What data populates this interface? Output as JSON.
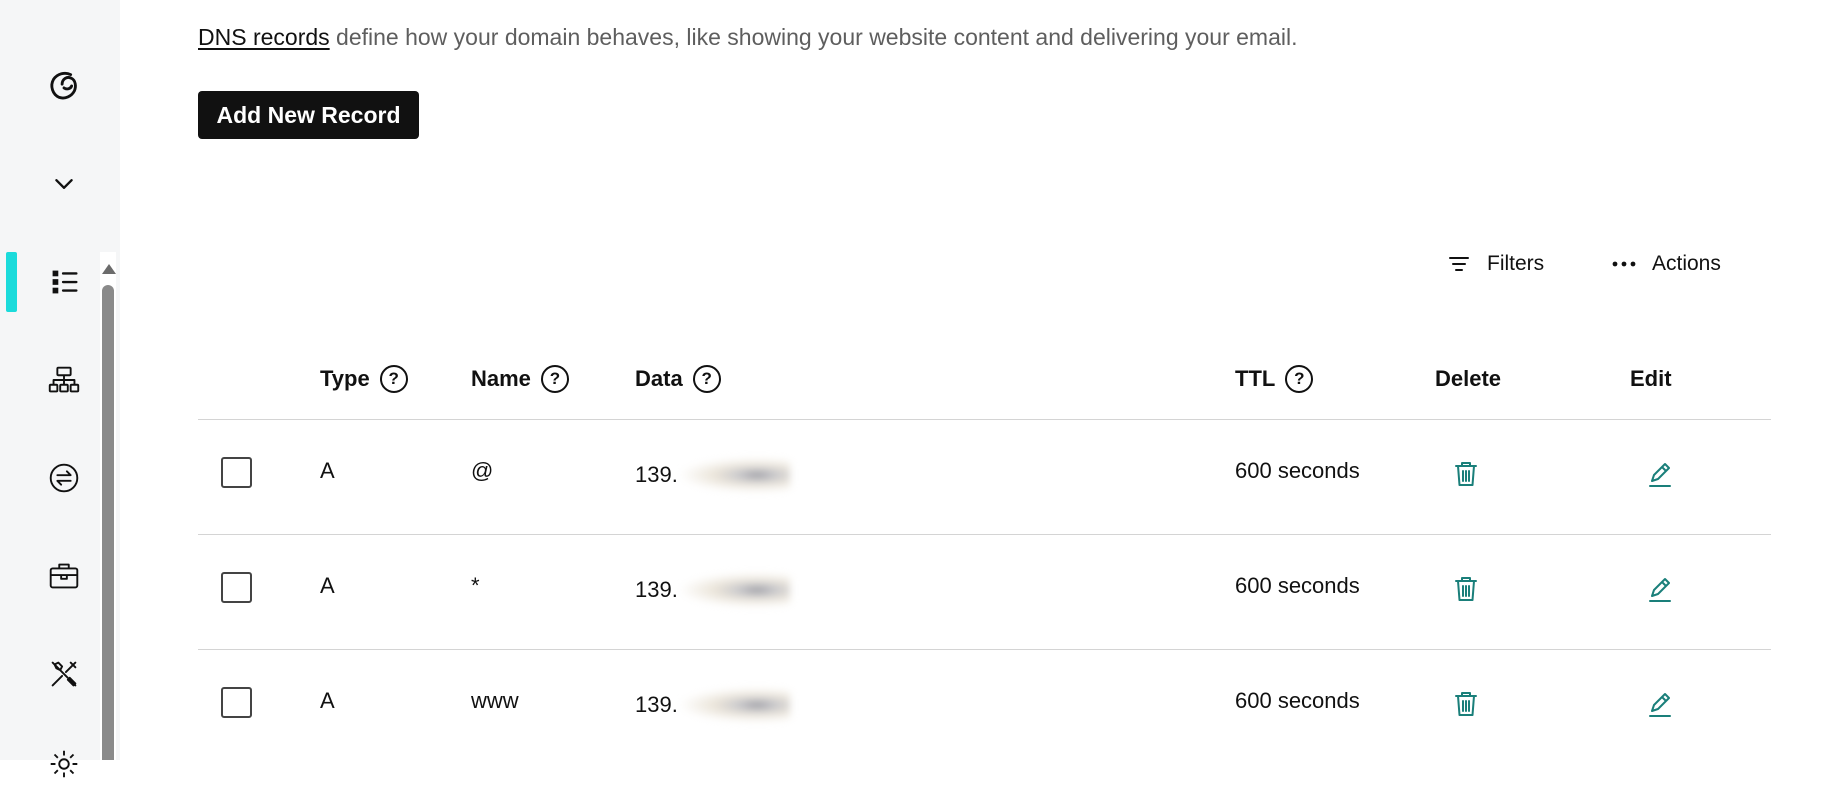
{
  "intro": {
    "link_text": "DNS records",
    "rest_text": " define how your domain behaves, like showing your website content and delivering your email."
  },
  "add_button_label": "Add New Record",
  "toolbar": {
    "filters_label": "Filters",
    "actions_label": "Actions"
  },
  "table": {
    "headers": {
      "type": "Type",
      "name": "Name",
      "data": "Data",
      "ttl": "TTL",
      "delete": "Delete",
      "edit": "Edit"
    },
    "help_glyph": "?",
    "rows": [
      {
        "type": "A",
        "name": "@",
        "data": "139.",
        "ttl": "600 seconds"
      },
      {
        "type": "A",
        "name": "*",
        "data": "139.",
        "ttl": "600 seconds"
      },
      {
        "type": "A",
        "name": "www",
        "data": "139.",
        "ttl": "600 seconds"
      }
    ]
  },
  "sidebar": {
    "items": [
      {
        "icon": "godaddy-logo-icon"
      },
      {
        "icon": "chevron-down-icon"
      },
      {
        "icon": "list-icon",
        "active": true
      },
      {
        "icon": "sitemap-icon"
      },
      {
        "icon": "transfer-icon"
      },
      {
        "icon": "briefcase-icon"
      },
      {
        "icon": "tools-icon"
      },
      {
        "icon": "gear-icon"
      }
    ]
  },
  "colors": {
    "active_accent": "#1bdbdb",
    "action_icon": "#1a7f7a",
    "button_bg": "#111111",
    "muted_text": "#5e5e5e"
  }
}
